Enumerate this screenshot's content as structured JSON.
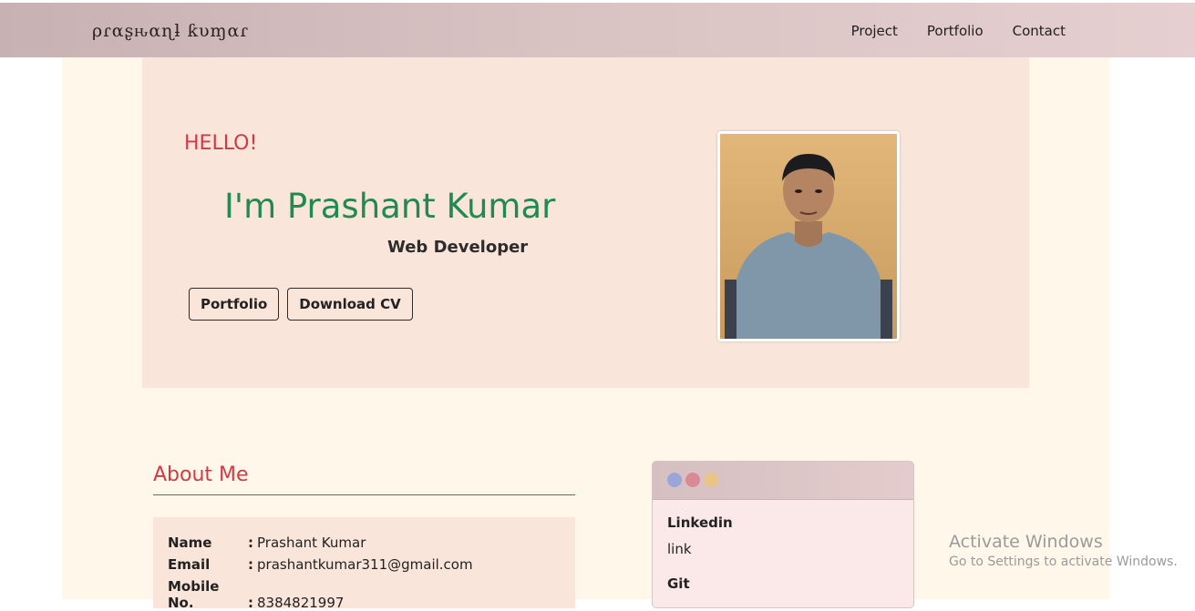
{
  "nav": {
    "brand": "ρɾαʂԋαɳƚ ƙυɱαɾ",
    "links": [
      "Project",
      "Portfolio",
      "Contact"
    ]
  },
  "hero": {
    "greeting": "HELLO!",
    "name": "I'm Prashant Kumar",
    "role": "Web Developer",
    "buttons": [
      "Portfolio",
      "Download CV"
    ]
  },
  "about": {
    "title": "About Me",
    "rows": [
      {
        "label": "Name",
        "value": "Prashant Kumar"
      },
      {
        "label": "Email",
        "value": "prashantkumar311@gmail.com"
      },
      {
        "label": "Mobile No.",
        "value": "8384821997"
      }
    ]
  },
  "links_card": {
    "items": [
      {
        "label": "Linkedin",
        "value": "link"
      },
      {
        "label": "Git",
        "value": ""
      }
    ]
  },
  "os_watermark": {
    "title": "Activate Windows",
    "subtitle": "Go to Settings to activate Windows."
  },
  "colors": {
    "accent_red": "#d13a44",
    "accent_green": "#218a52",
    "hero_bg": "#fae5db",
    "page_bg": "#fff8ea"
  }
}
